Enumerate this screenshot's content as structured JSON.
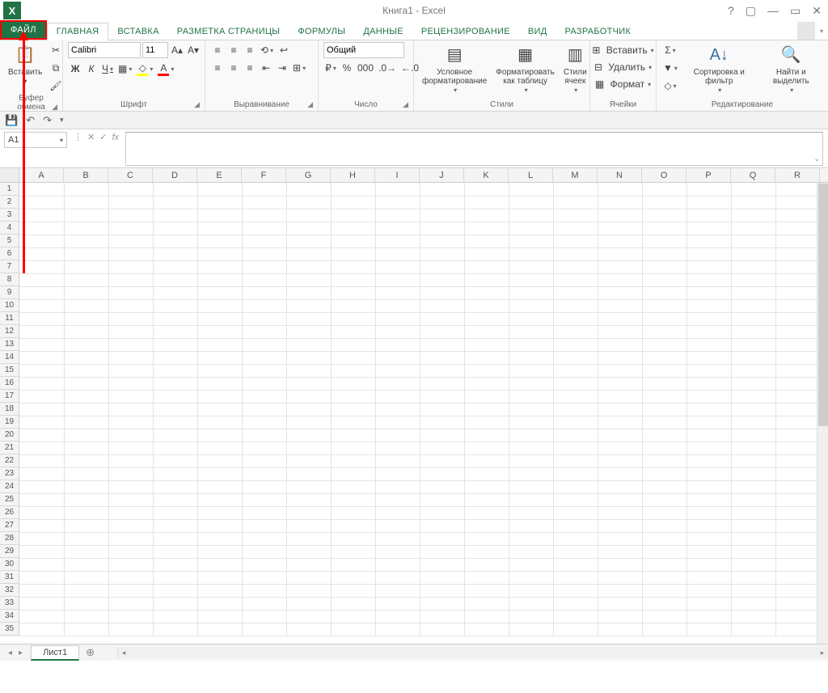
{
  "title": "Книга1 - Excel",
  "tabs": {
    "file": "ФАЙЛ",
    "items": [
      "ГЛАВНАЯ",
      "ВСТАВКА",
      "РАЗМЕТКА СТРАНИЦЫ",
      "ФОРМУЛЫ",
      "ДАННЫЕ",
      "РЕЦЕНЗИРОВАНИЕ",
      "ВИД",
      "РАЗРАБОТЧИК"
    ],
    "active_index": 0
  },
  "ribbon": {
    "clipboard": {
      "label": "Буфер обмена",
      "paste": "Вставить"
    },
    "font": {
      "label": "Шрифт",
      "name": "Calibri",
      "size": "11",
      "bold": "Ж",
      "italic": "К",
      "underline": "Ч"
    },
    "alignment": {
      "label": "Выравнивание"
    },
    "number": {
      "label": "Число",
      "format": "Общий"
    },
    "styles": {
      "label": "Стили",
      "conditional": "Условное форматирование",
      "table": "Форматировать как таблицу",
      "cell": "Стили ячеек"
    },
    "cells": {
      "label": "Ячейки",
      "insert": "Вставить",
      "delete": "Удалить",
      "format": "Формат"
    },
    "editing": {
      "label": "Редактирование",
      "sort": "Сортировка и фильтр",
      "find": "Найти и выделить"
    }
  },
  "namebox": "A1",
  "columns": [
    "A",
    "B",
    "C",
    "D",
    "E",
    "F",
    "G",
    "H",
    "I",
    "J",
    "K",
    "L",
    "M",
    "N",
    "O",
    "P",
    "Q",
    "R"
  ],
  "row_count": 35,
  "sheet": {
    "name": "Лист1"
  }
}
